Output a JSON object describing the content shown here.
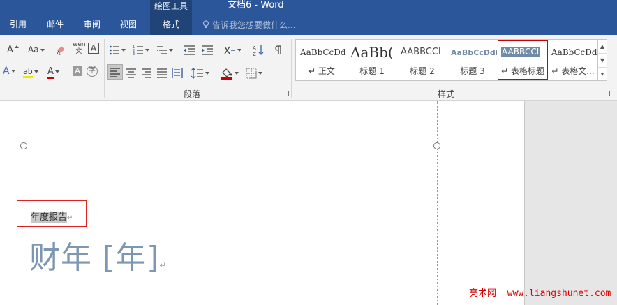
{
  "window": {
    "contextual_tools": "绘图工具",
    "doc_title": "文档6 - Word"
  },
  "tabs": [
    {
      "label": "引用"
    },
    {
      "label": "邮件"
    },
    {
      "label": "审阅"
    },
    {
      "label": "视图"
    },
    {
      "label": "格式",
      "active": true
    }
  ],
  "tell_me": {
    "placeholder": "告诉我您想要做什么..."
  },
  "ribbon": {
    "font_row1": {
      "font_size_up": "A",
      "change_case": "Aa",
      "phonetic": "wén 文",
      "char_border": "A"
    },
    "font_row2": {
      "effects": "A",
      "highlight": "ab",
      "font_color": "A",
      "shading": "A",
      "enclose": "字"
    },
    "groups": [
      {
        "label": "段落"
      },
      {
        "label": "样式"
      }
    ],
    "styles": [
      {
        "preview": "AaBbCcDd",
        "name": "↵ 正文"
      },
      {
        "preview": "AaBb(",
        "name": "标题 1"
      },
      {
        "preview": "AABBCCI",
        "name": "标题 2"
      },
      {
        "preview": "AaBbCcDdE",
        "name": "标题 3"
      },
      {
        "preview": "AABBCCI",
        "name": "↵ 表格标题",
        "selected": true
      },
      {
        "preview": "AaBbCcDd",
        "name": "↵ 表格文..."
      }
    ]
  },
  "document": {
    "small_text": "年度报告",
    "big_text": "财年 [年]",
    "pilcrow": "↵"
  },
  "watermark": {
    "cn": "亮术网",
    "url": "www.liangshunet.com"
  },
  "colors": {
    "ribbon_tab_bg": "#2b579a",
    "active_tab_bg": "#204478",
    "big_text": "#7d97b3",
    "selection_border": "#d22"
  }
}
